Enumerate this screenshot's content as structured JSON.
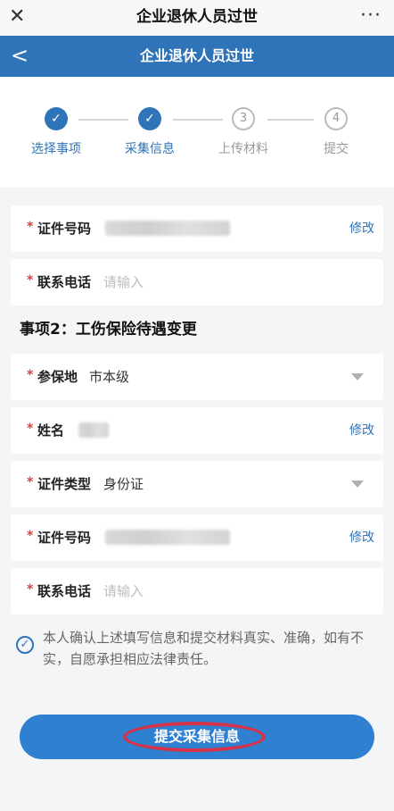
{
  "app": {
    "title": "企业退休人员过世",
    "close_glyph": "✕",
    "more_glyph": "···"
  },
  "nav": {
    "title": "企业退休人员过世",
    "back_glyph": "<"
  },
  "steps": [
    {
      "label": "选择事项",
      "state": "done",
      "mark": "✓"
    },
    {
      "label": "采集信息",
      "state": "done",
      "mark": "✓"
    },
    {
      "label": "上传材料",
      "state": "todo",
      "mark": "3"
    },
    {
      "label": "提交",
      "state": "todo",
      "mark": "4"
    }
  ],
  "form": {
    "fields": [
      {
        "label": "证件号码",
        "action": "修改"
      },
      {
        "label": "联系电话",
        "placeholder": "请输入"
      }
    ],
    "section2_title": "事项2：工伤保险待遇变更",
    "fields2": [
      {
        "label": "参保地",
        "value": "市本级"
      },
      {
        "label": "姓名",
        "action": "修改"
      },
      {
        "label": "证件类型",
        "value": "身份证"
      },
      {
        "label": "证件号码",
        "action": "修改"
      },
      {
        "label": "联系电话",
        "placeholder": "请输入"
      }
    ],
    "required_mark": "*"
  },
  "confirm": {
    "text": "本人确认上述填写信息和提交材料真实、准确，如有不实，自愿承担相应法律责任。",
    "checked": true,
    "check_glyph": "✓"
  },
  "submit": {
    "label": "提交采集信息"
  },
  "colors": {
    "accent": "#2f73b8",
    "required": "#e03b3b",
    "annotation": "#d6334a"
  }
}
